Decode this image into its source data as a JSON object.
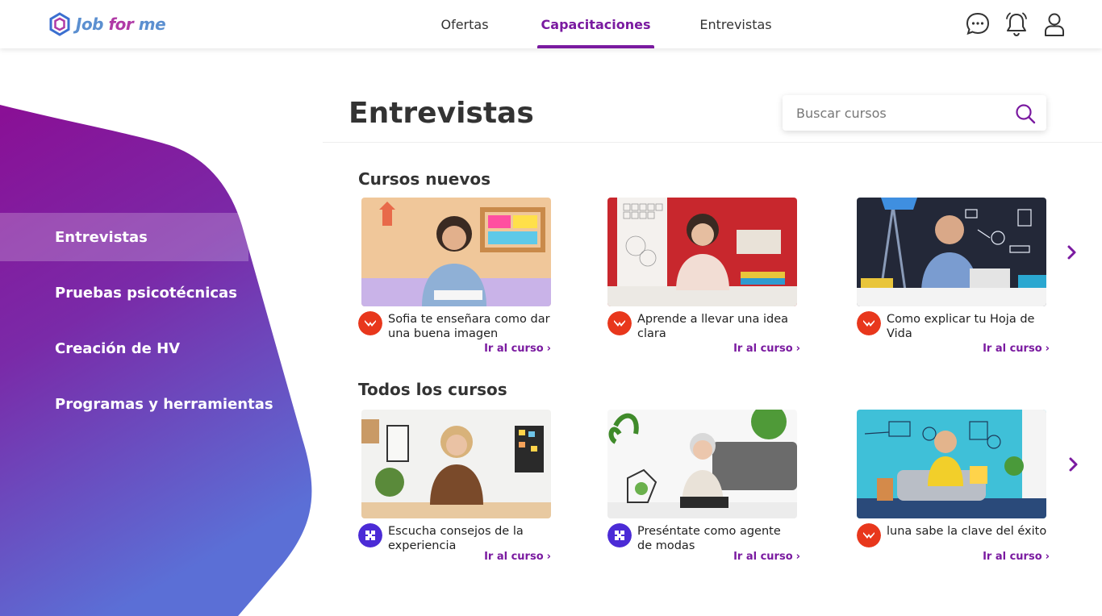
{
  "header": {
    "logo": {
      "job": "Job",
      "for": "for",
      "me": "me"
    },
    "nav": [
      {
        "label": "Ofertas",
        "active": false
      },
      {
        "label": "Capacitaciones",
        "active": true
      },
      {
        "label": "Entrevistas",
        "active": false
      }
    ],
    "icons": [
      "chat-icon",
      "bell-icon",
      "user-icon"
    ]
  },
  "sidebar": {
    "items": [
      {
        "label": "Entrevistas",
        "active": true
      },
      {
        "label": "Pruebas psicotécnicas",
        "active": false
      },
      {
        "label": "Creación de HV",
        "active": false
      },
      {
        "label": "Programas y herramientas",
        "active": false
      }
    ],
    "gradient": {
      "top": "#8a0f95",
      "bottom": "#5b6fd6"
    }
  },
  "main": {
    "title": "Entrevistas",
    "search": {
      "placeholder": "Buscar cursos",
      "value": ""
    },
    "sections": [
      {
        "title": "Cursos nuevos",
        "courses": [
          {
            "title": "Sofia te enseñara como dar una buena imagen",
            "link": "Ir al curso",
            "provider": "domestika-icon"
          },
          {
            "title": "Aprende a llevar una idea clara",
            "link": "Ir al curso",
            "provider": "domestika-icon"
          },
          {
            "title": "Como explicar tu Hoja de Vida",
            "link": "Ir al curso",
            "provider": "domestika-icon"
          }
        ]
      },
      {
        "title": "Todos los cursos",
        "courses": [
          {
            "title": "Escucha consejos de la experiencia",
            "link": "Ir al curso",
            "provider": "crehana-icon"
          },
          {
            "title": "Preséntate como agente de modas",
            "link": "Ir al curso",
            "provider": "crehana-icon"
          },
          {
            "title": "luna sabe la clave del éxito",
            "link": "Ir al curso",
            "provider": "domestika-icon"
          }
        ]
      }
    ]
  },
  "colors": {
    "accent": "#7a1aa0",
    "domestika": "#e8371c",
    "crehana": "#4b2bd6"
  }
}
